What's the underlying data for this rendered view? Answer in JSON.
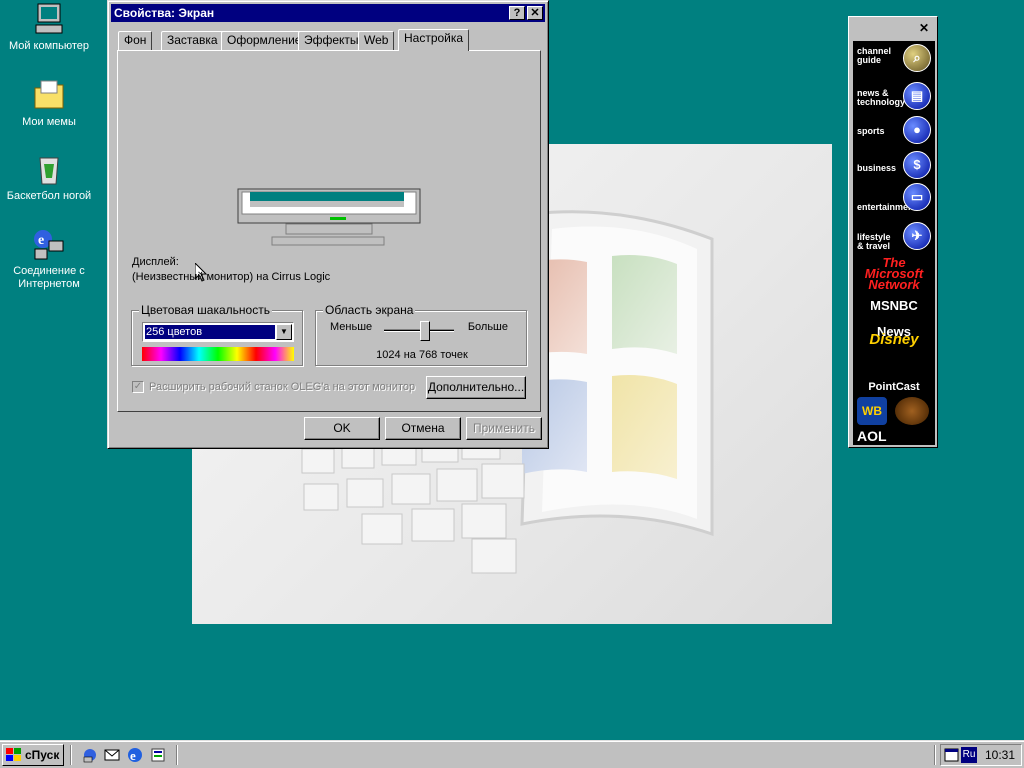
{
  "desktop": {
    "icons": [
      {
        "label": "Мой компьютер"
      },
      {
        "label": "Мои мемы"
      },
      {
        "label": "Баскетбол ногой"
      },
      {
        "label": "Соединение с Интернетом"
      }
    ]
  },
  "window": {
    "title": "Свойства: Экран",
    "help_label": "?",
    "close_label": "✕",
    "tabs": [
      {
        "label": "Фон"
      },
      {
        "label": "Заставка"
      },
      {
        "label": "Оформление"
      },
      {
        "label": "Эффекты"
      },
      {
        "label": "Web"
      },
      {
        "label": "Настройка"
      }
    ],
    "display_label": "Дисплей:",
    "display_value": "(Неизвестный монитор) на Cirrus Logic",
    "color_group": {
      "legend": "Цветовая шакальность",
      "selected": "256 цветов"
    },
    "screen_group": {
      "legend": "Область экрана",
      "less": "Меньше",
      "more": "Больше",
      "resolution": "1024 на 768 точек",
      "slider_level": 0.6
    },
    "extend_checkbox": "Расширить рабочий станок OLEG'а на этот монитор",
    "advanced_button": "Дополнительно...",
    "ok_button": "OK",
    "cancel_button": "Отмена",
    "apply_button": "Применить"
  },
  "channel_bar": {
    "close_label": "✕",
    "channels": [
      {
        "line1": "channel",
        "line2": "guide"
      },
      {
        "line1": "news &",
        "line2": "technology"
      },
      {
        "line1": "sports",
        "line2": ""
      },
      {
        "line1": "business",
        "line2": ""
      },
      {
        "line1": "entertainment",
        "line2": ""
      },
      {
        "line1": "lifestyle",
        "line2": "& travel"
      }
    ],
    "logos": [
      "The Microsoft Network",
      "MSNBC News",
      "Disney",
      "PointCast",
      "WB",
      "AOL"
    ]
  },
  "taskbar": {
    "start_label": "сПуск",
    "lang": "Ru",
    "clock": "10:31"
  },
  "colors": {
    "desktop": "#008080",
    "titlebar": "#000080",
    "face": "#c0c0c0"
  }
}
